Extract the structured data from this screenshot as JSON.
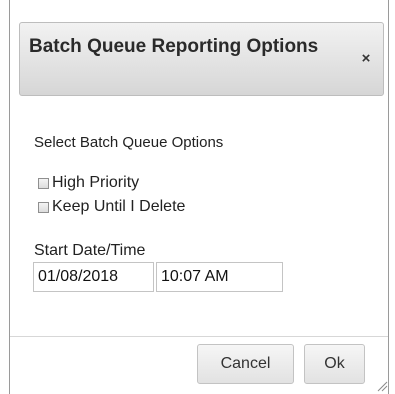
{
  "dialog": {
    "title": "Batch Queue Reporting Options",
    "close_glyph": "×"
  },
  "options": {
    "section_label": "Select Batch Queue Options",
    "checkboxes": [
      {
        "label": "High Priority",
        "checked": false
      },
      {
        "label": "Keep Until I Delete",
        "checked": false
      }
    ]
  },
  "start": {
    "label": "Start Date/Time",
    "date_value": "01/08/2018",
    "time_value": "10:07 AM"
  },
  "buttons": {
    "cancel_label": "Cancel",
    "ok_label": "Ok"
  },
  "icons": {
    "close": "close-icon",
    "resize": "resize-grip-icon"
  },
  "colors": {
    "titlebar_top": "#f2f2f2",
    "titlebar_bottom": "#d6d6d6",
    "border": "#9a9a9a"
  }
}
